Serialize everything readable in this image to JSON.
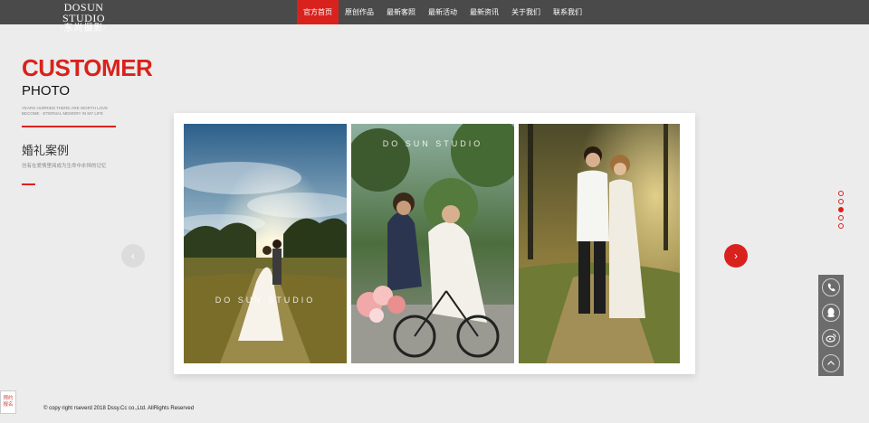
{
  "header": {
    "logo_main": "DOSUN STUDIO",
    "logo_sub": "·东尚摄影·",
    "nav": [
      {
        "label": "官方首页",
        "active": true
      },
      {
        "label": "原创作品",
        "active": false
      },
      {
        "label": "最新客照",
        "active": false
      },
      {
        "label": "最新活动",
        "active": false
      },
      {
        "label": "最新资讯",
        "active": false
      },
      {
        "label": "关于我们",
        "active": false
      },
      {
        "label": "联系我们",
        "active": false
      }
    ]
  },
  "hero": {
    "title": "CUSTOMER",
    "subtitle": "PHOTO",
    "tagline": "YEARS HURRIED THERE ARE WORTH LOVE BECOME · ETERNAL MEMORY IN MY LIFE",
    "case_title": "婚礼案例",
    "case_desc": "岂有在爱情里阅成为生命中永恒的记忆"
  },
  "gallery": {
    "watermark": "DO SUN STUDIO",
    "watermark_sub": "东尚摄影",
    "photos": [
      "wedding-field-photo",
      "bicycle-couple-photo",
      "forest-couple-photo"
    ]
  },
  "carousel": {
    "prev_icon": "‹",
    "next_icon": "›",
    "dot_count": 5,
    "active_dot": 3
  },
  "side_tools": {
    "icons": [
      "phone-icon",
      "qq-icon",
      "weibo-icon",
      "back-to-top-icon"
    ]
  },
  "appointment": {
    "label": "预约报名"
  },
  "footer": {
    "copyright": "© copy right rseverd 2018 Dssy.Cc co.,Ltd. AllRights Reserved"
  },
  "colors": {
    "accent": "#d9221d",
    "topbar": "#4a4a4a",
    "background": "#ececec"
  }
}
